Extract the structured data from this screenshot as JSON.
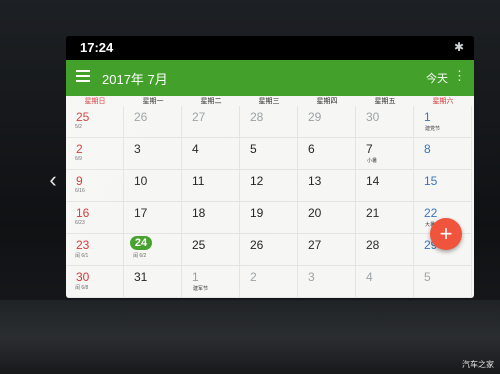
{
  "status": {
    "time": "17:24",
    "bluetooth_icon": "bluetooth-icon"
  },
  "appbar": {
    "title": "2017年 7月",
    "today_label": "今天",
    "menu_icon": "menu-icon",
    "overflow_icon": "more-vert-icon",
    "color": "#43a02a"
  },
  "weekdays": [
    "星期日",
    "星期一",
    "星期二",
    "星期三",
    "星期四",
    "星期五",
    "星期六"
  ],
  "weeks": [
    [
      {
        "day": "25",
        "style": "red",
        "sub": "5/2"
      },
      {
        "day": "26",
        "style": "muted",
        "sub": ""
      },
      {
        "day": "27",
        "style": "muted",
        "sub": ""
      },
      {
        "day": "28",
        "style": "muted",
        "sub": ""
      },
      {
        "day": "29",
        "style": "muted",
        "sub": ""
      },
      {
        "day": "30",
        "style": "muted",
        "sub": ""
      },
      {
        "day": "1",
        "style": "blue",
        "sub": "",
        "event": "建党节"
      }
    ],
    [
      {
        "day": "2",
        "style": "red",
        "sub": "6/9"
      },
      {
        "day": "3",
        "style": "",
        "sub": ""
      },
      {
        "day": "4",
        "style": "",
        "sub": ""
      },
      {
        "day": "5",
        "style": "",
        "sub": ""
      },
      {
        "day": "6",
        "style": "",
        "sub": ""
      },
      {
        "day": "7",
        "style": "",
        "sub": "",
        "event": "小暑"
      },
      {
        "day": "8",
        "style": "blue",
        "sub": ""
      }
    ],
    [
      {
        "day": "9",
        "style": "red",
        "sub": "6/16"
      },
      {
        "day": "10",
        "style": "",
        "sub": ""
      },
      {
        "day": "11",
        "style": "",
        "sub": ""
      },
      {
        "day": "12",
        "style": "",
        "sub": ""
      },
      {
        "day": "13",
        "style": "",
        "sub": ""
      },
      {
        "day": "14",
        "style": "",
        "sub": ""
      },
      {
        "day": "15",
        "style": "blue",
        "sub": ""
      }
    ],
    [
      {
        "day": "16",
        "style": "red",
        "sub": "6/23"
      },
      {
        "day": "17",
        "style": "",
        "sub": ""
      },
      {
        "day": "18",
        "style": "",
        "sub": ""
      },
      {
        "day": "19",
        "style": "",
        "sub": ""
      },
      {
        "day": "20",
        "style": "",
        "sub": ""
      },
      {
        "day": "21",
        "style": "",
        "sub": ""
      },
      {
        "day": "22",
        "style": "blue",
        "sub": "",
        "event": "大暑"
      }
    ],
    [
      {
        "day": "23",
        "style": "red",
        "sub": "闰 6/1"
      },
      {
        "day": "24",
        "style": "today",
        "sub": "闰 6/2"
      },
      {
        "day": "25",
        "style": "",
        "sub": ""
      },
      {
        "day": "26",
        "style": "",
        "sub": ""
      },
      {
        "day": "27",
        "style": "",
        "sub": ""
      },
      {
        "day": "28",
        "style": "",
        "sub": ""
      },
      {
        "day": "29",
        "style": "blue",
        "sub": ""
      }
    ],
    [
      {
        "day": "30",
        "style": "red",
        "sub": "闰 6/8"
      },
      {
        "day": "31",
        "style": "",
        "sub": ""
      },
      {
        "day": "1",
        "style": "muted",
        "sub": "",
        "event": "建军节"
      },
      {
        "day": "2",
        "style": "muted",
        "sub": ""
      },
      {
        "day": "3",
        "style": "muted",
        "sub": ""
      },
      {
        "day": "4",
        "style": "muted",
        "sub": ""
      },
      {
        "day": "5",
        "style": "muted",
        "sub": ""
      }
    ]
  ],
  "fab": {
    "label": "+",
    "color": "#f0543c",
    "icon": "add-icon"
  },
  "watermark": "汽车之家"
}
